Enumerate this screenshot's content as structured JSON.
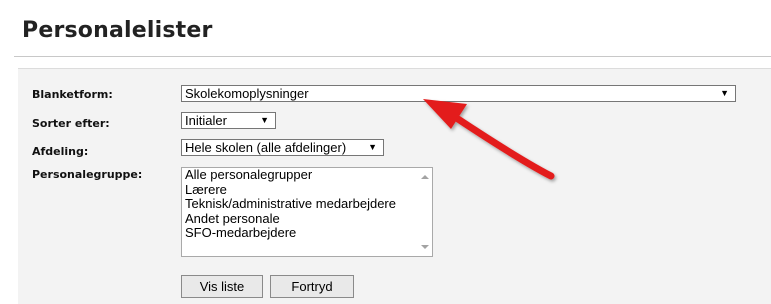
{
  "page": {
    "title": "Personalelister"
  },
  "form": {
    "blanketform": {
      "label": "Blanketform:",
      "value": "Skolekomoplysninger"
    },
    "sorter": {
      "label": "Sorter efter:",
      "value": "Initialer"
    },
    "afdeling": {
      "label": "Afdeling:",
      "value": "Hele skolen (alle afdelinger)"
    },
    "personalegruppe": {
      "label": "Personalegruppe:",
      "options": [
        "Alle personalegrupper",
        "Lærere",
        "Teknisk/administrative medarbejdere",
        "Andet personale",
        "SFO-medarbejdere"
      ]
    }
  },
  "buttons": {
    "show": "Vis liste",
    "cancel": "Fortryd"
  },
  "annotation": {
    "color": "#e31c1c"
  },
  "icons": {
    "dropdown": "chevron-down-icon",
    "annotation": "red-arrow-icon"
  }
}
